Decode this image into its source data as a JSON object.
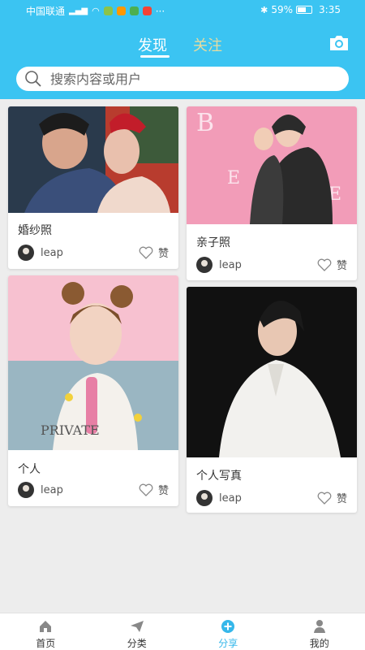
{
  "status_bar": {
    "carrier": "中国联通",
    "battery": "59%",
    "time": "3:35"
  },
  "header": {
    "tabs": [
      {
        "label": "发现"
      },
      {
        "label": "关注"
      }
    ],
    "camera_icon": "camera-icon"
  },
  "search": {
    "placeholder": "搜索内容或用户"
  },
  "cards": [
    {
      "title": "婚纱照",
      "user": "leap",
      "like_label": "赞"
    },
    {
      "title": "亲子照",
      "user": "leap",
      "like_label": "赞"
    },
    {
      "title": "个人",
      "user": "leap",
      "like_label": "赞",
      "image_text": "PRIVATE"
    },
    {
      "title": "个人写真",
      "user": "leap",
      "like_label": "赞"
    }
  ],
  "bottom_nav": [
    {
      "label": "首页",
      "icon": "home-icon"
    },
    {
      "label": "分类",
      "icon": "paper-plane-icon"
    },
    {
      "label": "分享",
      "icon": "plus-circle-icon",
      "active": true
    },
    {
      "label": "我的",
      "icon": "user-icon"
    }
  ],
  "colors": {
    "accent": "#3bc4f2",
    "active_nav": "#35b7ea"
  }
}
